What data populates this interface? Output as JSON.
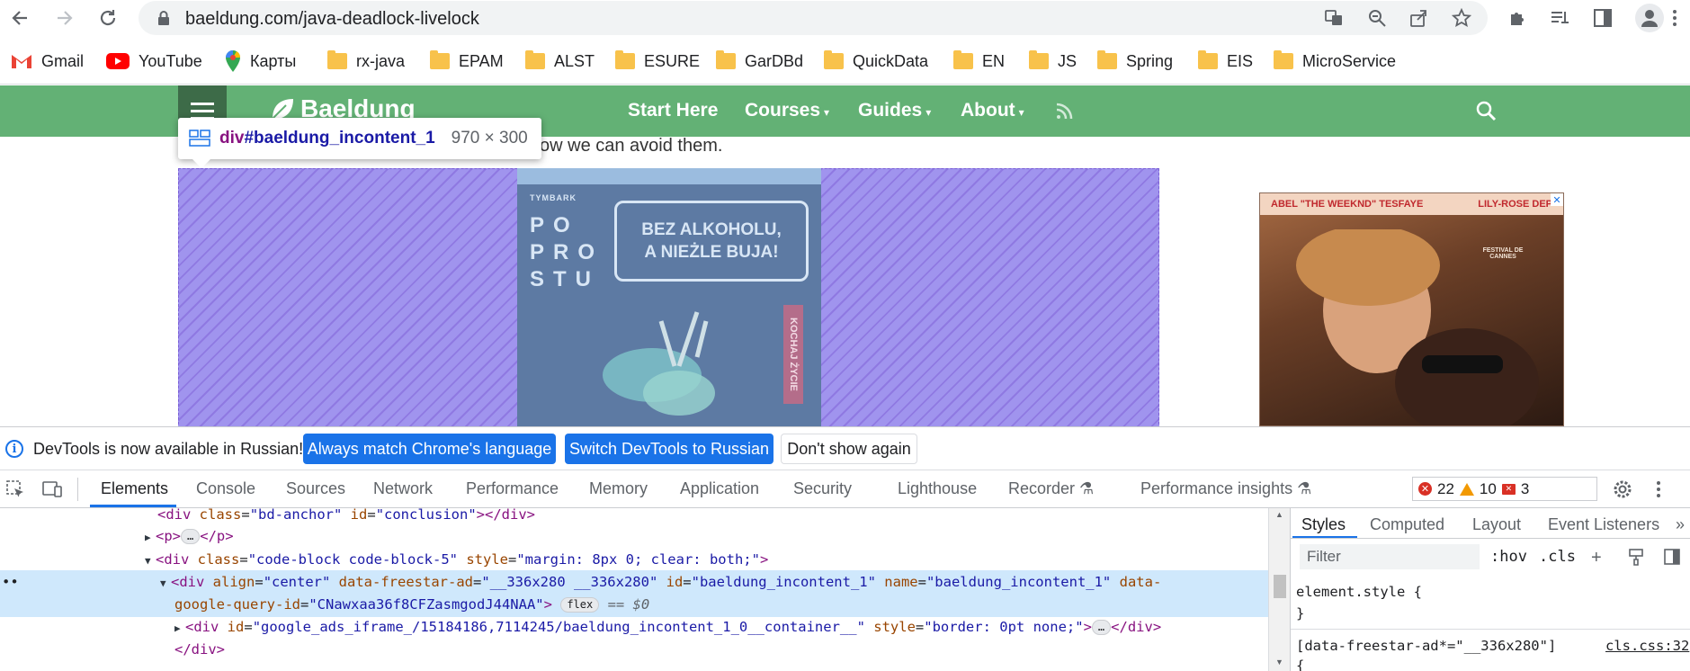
{
  "browser": {
    "url": "baeldung.com/java-deadlock-livelock",
    "icons": [
      "back-icon",
      "forward-icon",
      "reload-icon",
      "lock-icon",
      "translate-icon",
      "zoom-icon",
      "share-icon",
      "star-icon",
      "extensions-icon",
      "reading-list-icon",
      "side-panel-icon",
      "profile-icon",
      "more-icon"
    ]
  },
  "bookmarks": [
    {
      "label": "Gmail",
      "icon": "gmail-icon"
    },
    {
      "label": "YouTube",
      "icon": "youtube-icon"
    },
    {
      "label": "Карты",
      "icon": "maps-icon"
    },
    {
      "label": "rx-java",
      "icon": "folder-icon"
    },
    {
      "label": "EPAM",
      "icon": "folder-icon"
    },
    {
      "label": "ALST",
      "icon": "folder-icon"
    },
    {
      "label": "ESURE",
      "icon": "folder-icon"
    },
    {
      "label": "GarDBd",
      "icon": "folder-icon"
    },
    {
      "label": "QuickData",
      "icon": "folder-icon"
    },
    {
      "label": "EN",
      "icon": "folder-icon"
    },
    {
      "label": "JS",
      "icon": "folder-icon"
    },
    {
      "label": "Spring",
      "icon": "folder-icon"
    },
    {
      "label": "EIS",
      "icon": "folder-icon"
    },
    {
      "label": "MicroService",
      "icon": "folder-icon"
    }
  ],
  "site": {
    "logo": "Baeldung",
    "nav": [
      "Start Here",
      "Courses",
      "Guides",
      "About"
    ],
    "content_text": "ow we can avoid them.",
    "colors": {
      "nav": "#63b175",
      "menu": "#3d6b48",
      "highlight": "#a094ee"
    }
  },
  "inspect_tooltip": {
    "tag": "div",
    "id": "#baeldung_incontent_1",
    "size": "970 × 300"
  },
  "ad_center": {
    "brand": "TYMBARK",
    "words": [
      "PO",
      "PRO",
      "STU"
    ],
    "bubble_line1": "BEZ ALKOHOLU,",
    "bubble_line2": "A NIEŻLE BUJA!",
    "vertical": "KOCHAJ ŻYCIE"
  },
  "ad_right": {
    "left_text": "ABEL \"THE WEEKND\" TESFAYE",
    "right_text": "LILY-ROSE DEP",
    "festival": "FESTIVAL DE CANNES",
    "close": "✕"
  },
  "devtools": {
    "infobar": {
      "message": "DevTools is now available in Russian!",
      "btn_match": "Always match Chrome's language",
      "btn_switch": "Switch DevTools to Russian",
      "btn_dismiss": "Don't show again"
    },
    "tabs": [
      "Elements",
      "Console",
      "Sources",
      "Network",
      "Performance",
      "Memory",
      "Application",
      "Security",
      "Lighthouse",
      "Recorder",
      "Performance insights"
    ],
    "counts": {
      "errors": "22",
      "warnings": "10",
      "issues": "3"
    },
    "dom": {
      "l1": {
        "tag_open": "<div ",
        "a1": "class",
        "v1": "\"bd-anchor\"",
        "a2": " id",
        "v2": "\"conclusion\"",
        "tag_close": "></div>"
      },
      "l2": {
        "text": "<p>",
        "ellipsis": "…",
        "close": "</p>"
      },
      "l3": {
        "tag_open": "<div ",
        "a1": "class",
        "v1": "\"code-block code-block-5\"",
        "a2": " style",
        "v2": "\"margin: 8px 0; clear: both;\"",
        "tag_close": ">"
      },
      "l4": {
        "tag_open": "<div ",
        "a1": "align",
        "v1": "\"center\"",
        "a2": " data-freestar-ad",
        "v2": "\"__336x280 __336x280\"",
        "a3": " id",
        "v3": "\"baeldung_incontent_1\"",
        "a4": " name",
        "v4": "\"baeldung_incontent_1\"",
        "a5": " data-"
      },
      "l5": {
        "a": "google-query-id",
        "v": "\"CNawxaa36f8CFZasmgodJ44NAA\"",
        "close": ">",
        "pill": "flex",
        "eq": "== $0"
      },
      "l6": {
        "tag_open": "<div ",
        "a1": "id",
        "v1": "\"google_ads_iframe_/15184186,7114245/baeldung_incontent_1_0__container__\"",
        "a2": " style",
        "v2": "\"border: 0pt none;\"",
        "close": ">",
        "ellipsis": "…",
        "end": "</div>"
      },
      "l7": {
        "text": "</div>"
      },
      "gutter": "••"
    },
    "styles": {
      "tabs": [
        "Styles",
        "Computed",
        "Layout",
        "Event Listeners"
      ],
      "filter": "Filter",
      "hov": ":hov",
      "cls": ".cls",
      "element_style": "element.style {",
      "brace_close": "}",
      "rule_selector": "[data-freestar-ad*=\"__336x280\"]",
      "rule_source": "cls.css:32",
      "brace_open": "{"
    }
  }
}
